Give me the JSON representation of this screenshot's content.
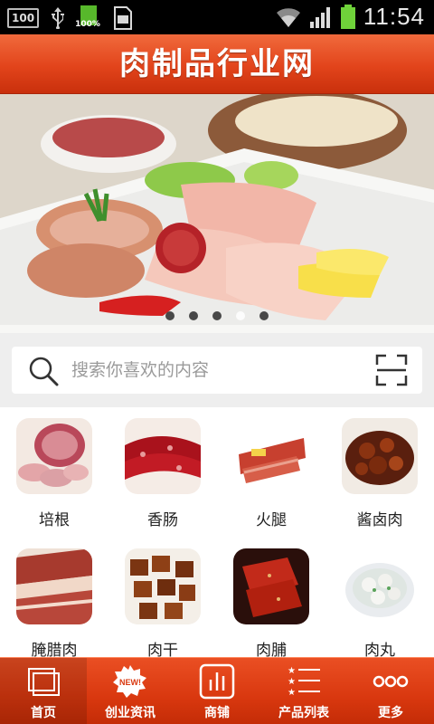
{
  "statusbar": {
    "left_badge": "100",
    "battery_percent": "100%",
    "time": "11:54"
  },
  "header": {
    "title": "肉制品行业网"
  },
  "banner": {
    "slide_count": 5,
    "active_index": 3
  },
  "search": {
    "placeholder": "搜索你喜欢的内容"
  },
  "categories": [
    {
      "label": "培根",
      "icon": "bacon-roll"
    },
    {
      "label": "香肠",
      "icon": "sausage"
    },
    {
      "label": "火腿",
      "icon": "ham-pack"
    },
    {
      "label": "酱卤肉",
      "icon": "braised-meat"
    },
    {
      "label": "腌腊肉",
      "icon": "cured-meat"
    },
    {
      "label": "肉干",
      "icon": "jerky-cubes"
    },
    {
      "label": "肉脯",
      "icon": "pork-slices"
    },
    {
      "label": "肉丸",
      "icon": "meatball-bowl"
    }
  ],
  "tabbar": {
    "tabs": [
      {
        "label": "首页",
        "icon": "home-icon",
        "active": true
      },
      {
        "label": "创业资讯",
        "icon": "news-icon",
        "badge": "NEW!"
      },
      {
        "label": "商铺",
        "icon": "shop-chart-icon"
      },
      {
        "label": "产品列表",
        "icon": "list-icon"
      },
      {
        "label": "更多",
        "icon": "more-icon"
      }
    ]
  },
  "colors": {
    "brand": "#e2441b",
    "tabbar": "#d9380f"
  }
}
